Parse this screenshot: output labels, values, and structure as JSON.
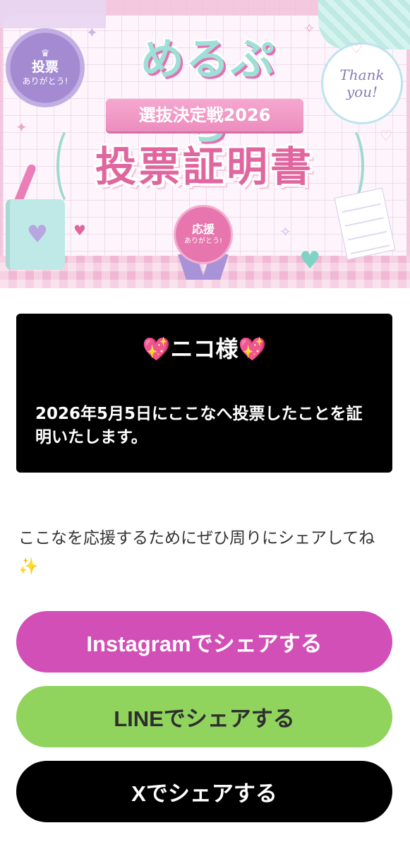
{
  "banner": {
    "seal_line1": "投票",
    "seal_line2": "ありがとう!",
    "logo": "めるぷち",
    "subtitle": "選抜決定戦2026",
    "title": "投票証明書",
    "thanks_line1": "Thank",
    "thanks_line2": "you!",
    "medal_line1": "応援",
    "medal_line2": "ありがとう!"
  },
  "certificate": {
    "name": "💖ニコ様💖",
    "body": "2026年5月5日にここなへ投票したことを証明いたします。"
  },
  "share": {
    "prompt": "ここなを応援するためにぜひ周りにシェアしてね✨"
  },
  "buttons": {
    "instagram": "Instagramでシェアする",
    "line": "LINEでシェアする",
    "x": "Xでシェアする"
  },
  "colors": {
    "instagram": "#d24fb7",
    "line": "#90d45e",
    "x": "#000000",
    "card": "#000000"
  },
  "icons": {
    "sparkling_heart": "💖",
    "sparkles": "✨"
  }
}
